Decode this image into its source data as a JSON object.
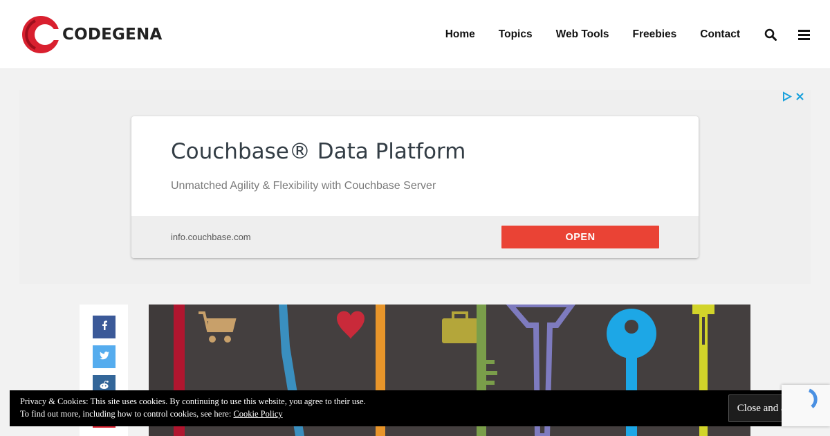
{
  "site": {
    "logo_text": "CODEGENA",
    "brand_color": "#d9202f"
  },
  "nav": {
    "items": [
      {
        "label": "Home"
      },
      {
        "label": "Topics"
      },
      {
        "label": "Web Tools"
      },
      {
        "label": "Freebies"
      },
      {
        "label": "Contact"
      }
    ],
    "icons": [
      "search-icon",
      "menu-icon"
    ]
  },
  "ad": {
    "title": "Couchbase® Data Platform",
    "description": "Unmatched Agility & Flexibility with Couchbase Server",
    "url": "info.couchbase.com",
    "cta": "OPEN",
    "cta_color": "#ea4335",
    "choices_icons": [
      "adchoices-icon",
      "close-icon"
    ]
  },
  "share": {
    "buttons": [
      {
        "icon": "facebook-icon",
        "color": "#3b5998"
      },
      {
        "icon": "twitter-icon",
        "color": "#55acee"
      },
      {
        "icon": "reddit-icon",
        "color": "#336699"
      }
    ]
  },
  "cookie": {
    "line1": "Privacy & Cookies: This site uses cookies. By continuing to use this website, you agree to their use.",
    "line2_prefix": "To find out more, including how to control cookies, see here: ",
    "link": "Cookie Policy",
    "button": "Close and accept"
  }
}
